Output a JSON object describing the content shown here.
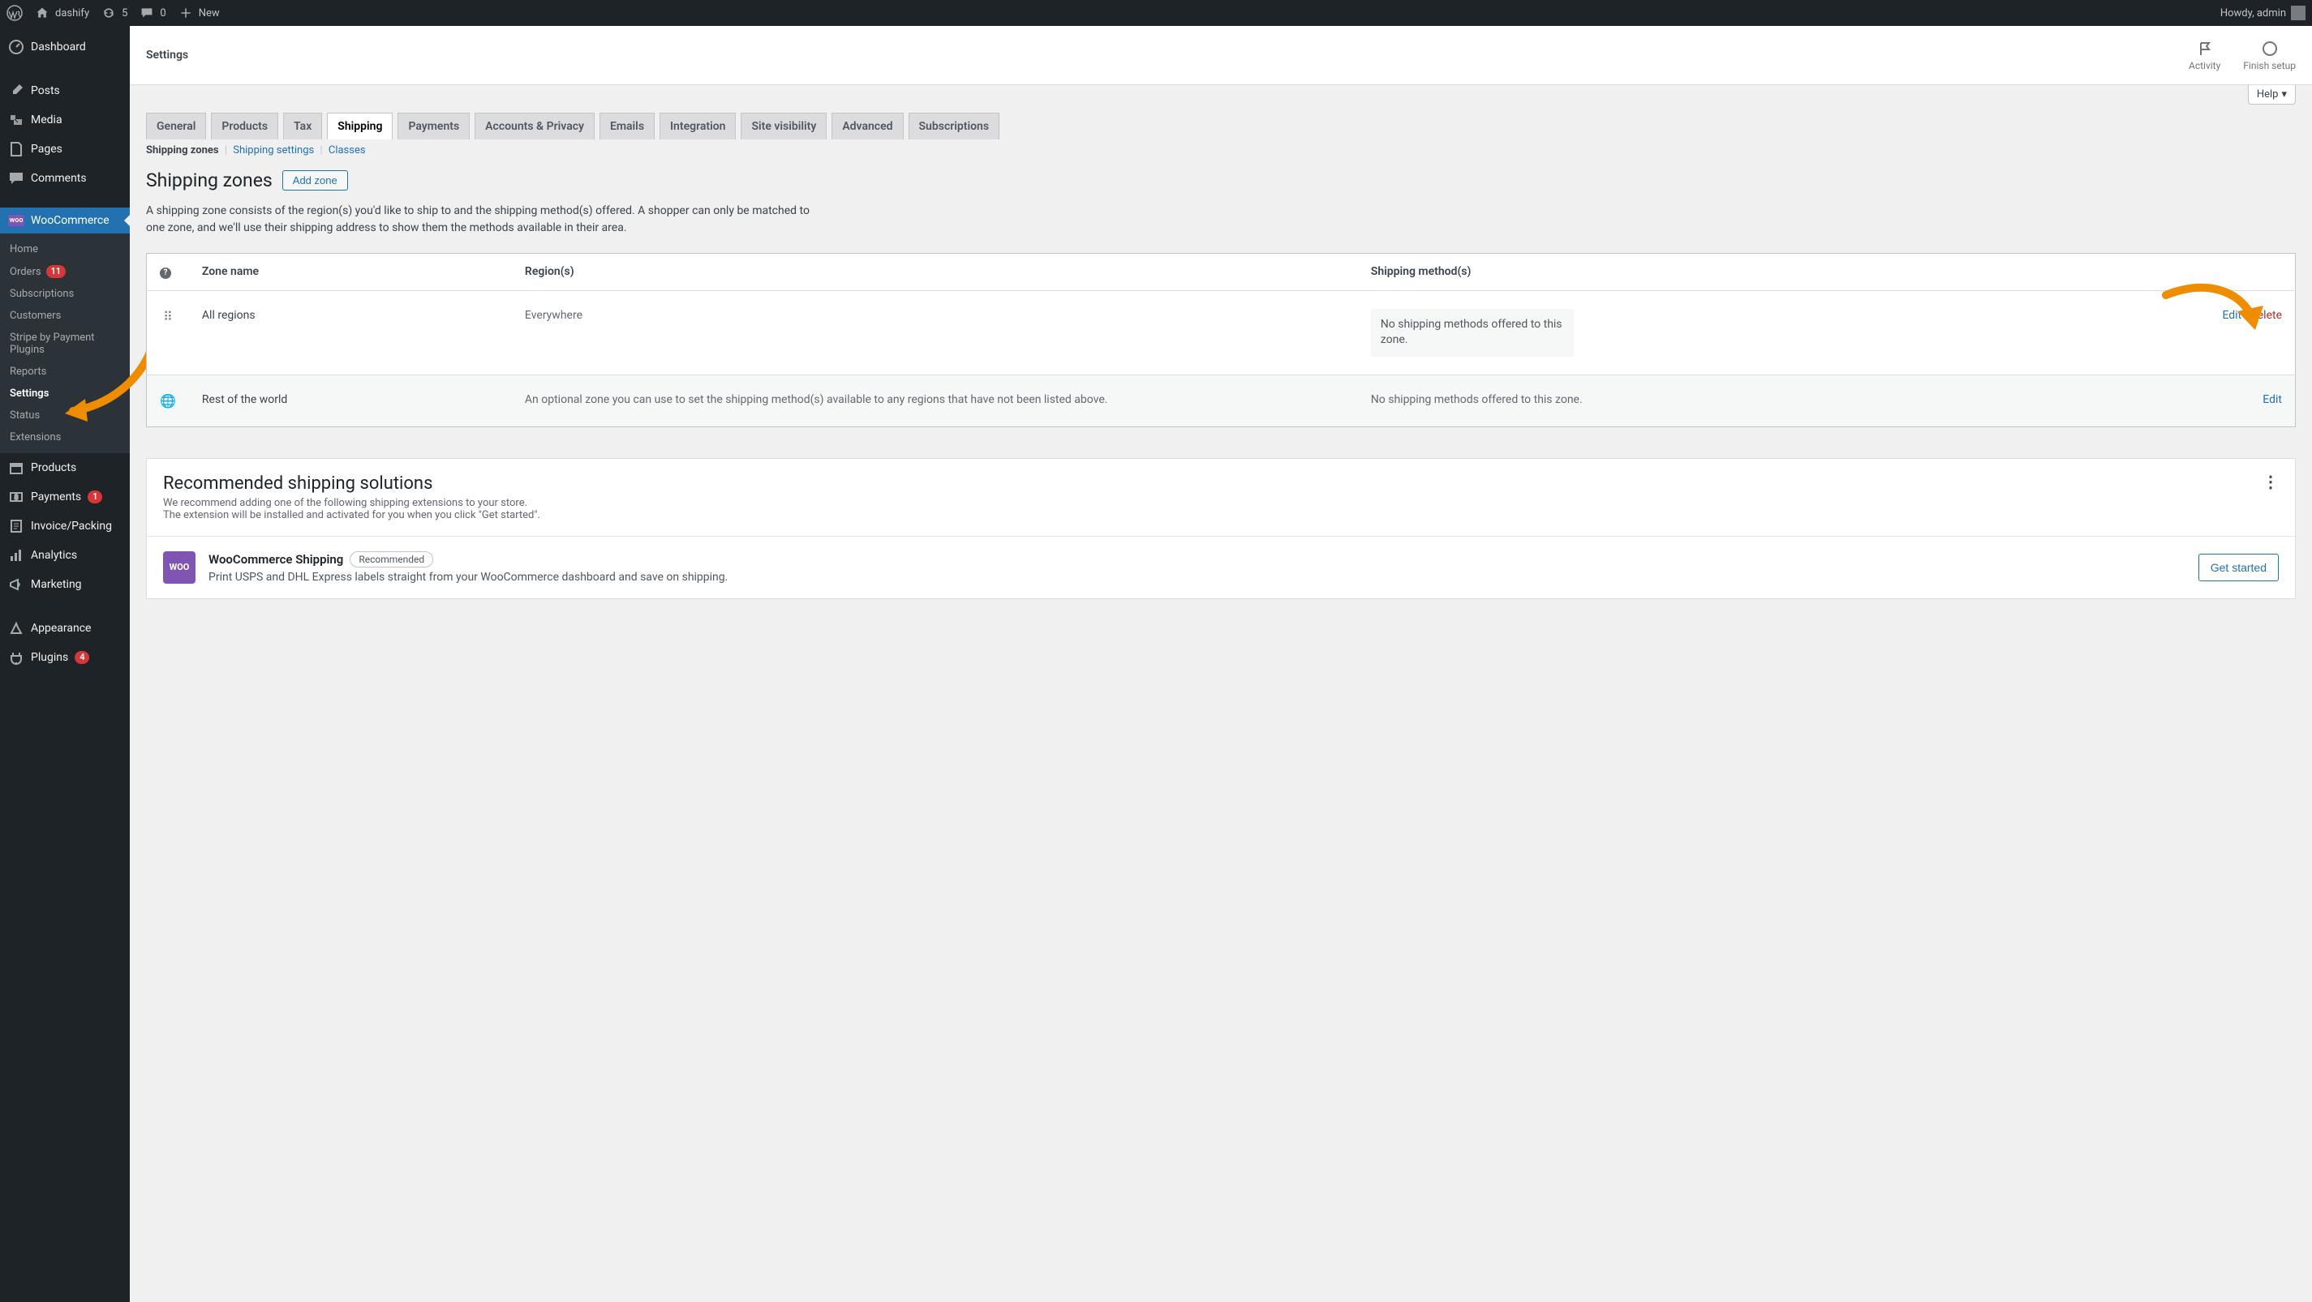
{
  "admin_bar": {
    "site_name": "dashify",
    "refresh_count": "5",
    "comments_count": "0",
    "new_label": "New",
    "howdy": "Howdy, admin"
  },
  "sidebar": {
    "items": [
      {
        "label": "Dashboard",
        "icon": "dashboard"
      },
      {
        "label": "Posts",
        "icon": "pin"
      },
      {
        "label": "Media",
        "icon": "media"
      },
      {
        "label": "Pages",
        "icon": "page"
      },
      {
        "label": "Comments",
        "icon": "comment"
      },
      {
        "label": "WooCommerce",
        "icon": "woo"
      },
      {
        "label": "Products",
        "icon": "products"
      },
      {
        "label": "Payments",
        "icon": "payments",
        "count": "1"
      },
      {
        "label": "Invoice/Packing",
        "icon": "invoice"
      },
      {
        "label": "Analytics",
        "icon": "analytics"
      },
      {
        "label": "Marketing",
        "icon": "marketing"
      },
      {
        "label": "Appearance",
        "icon": "appearance"
      },
      {
        "label": "Plugins",
        "icon": "plugins",
        "count": "4"
      }
    ],
    "woo_submenu": [
      {
        "label": "Home"
      },
      {
        "label": "Orders",
        "count": "11"
      },
      {
        "label": "Subscriptions"
      },
      {
        "label": "Customers"
      },
      {
        "label": "Stripe by Payment Plugins"
      },
      {
        "label": "Reports"
      },
      {
        "label": "Settings",
        "active": true
      },
      {
        "label": "Status"
      },
      {
        "label": "Extensions"
      }
    ]
  },
  "page_header": {
    "title": "Settings",
    "activity": "Activity",
    "finish_setup": "Finish setup",
    "help": "Help"
  },
  "tabs": [
    {
      "label": "General"
    },
    {
      "label": "Products"
    },
    {
      "label": "Tax"
    },
    {
      "label": "Shipping",
      "active": true
    },
    {
      "label": "Payments"
    },
    {
      "label": "Accounts & Privacy"
    },
    {
      "label": "Emails"
    },
    {
      "label": "Integration"
    },
    {
      "label": "Site visibility"
    },
    {
      "label": "Advanced"
    },
    {
      "label": "Subscriptions"
    }
  ],
  "sub_tabs": {
    "zones": "Shipping zones",
    "settings": "Shipping settings",
    "classes": "Classes"
  },
  "zones": {
    "heading": "Shipping zones",
    "add_btn": "Add zone",
    "description": "A shipping zone consists of the region(s) you'd like to ship to and the shipping method(s) offered. A shopper can only be matched to one zone, and we'll use their shipping address to show them the methods available in their area.",
    "columns": {
      "name": "Zone name",
      "regions": "Region(s)",
      "methods": "Shipping method(s)"
    },
    "rows": [
      {
        "name": "All regions",
        "regions": "Everywhere",
        "no_methods": "No shipping methods offered to this zone.",
        "edit": "Edit",
        "delete": "Delete"
      },
      {
        "name": "Rest of the world",
        "regions": "An optional zone you can use to set the shipping method(s) available to any regions that have not been listed above.",
        "no_methods_plain": "No shipping methods offered to this zone.",
        "edit": "Edit"
      }
    ]
  },
  "reco": {
    "heading": "Recommended shipping solutions",
    "line1": "We recommend adding one of the following shipping extensions to your store.",
    "line2": "The extension will be installed and activated for you when you click \"Get started\".",
    "logo_text": "WOO",
    "title": "WooCommerce Shipping",
    "badge": "Recommended",
    "desc": "Print USPS and DHL Express labels straight from your WooCommerce dashboard and save on shipping.",
    "get_started": "Get started"
  },
  "colors": {
    "accent_orange": "#f08c00",
    "accent_blue": "#2271b1",
    "danger": "#b32d2e"
  }
}
